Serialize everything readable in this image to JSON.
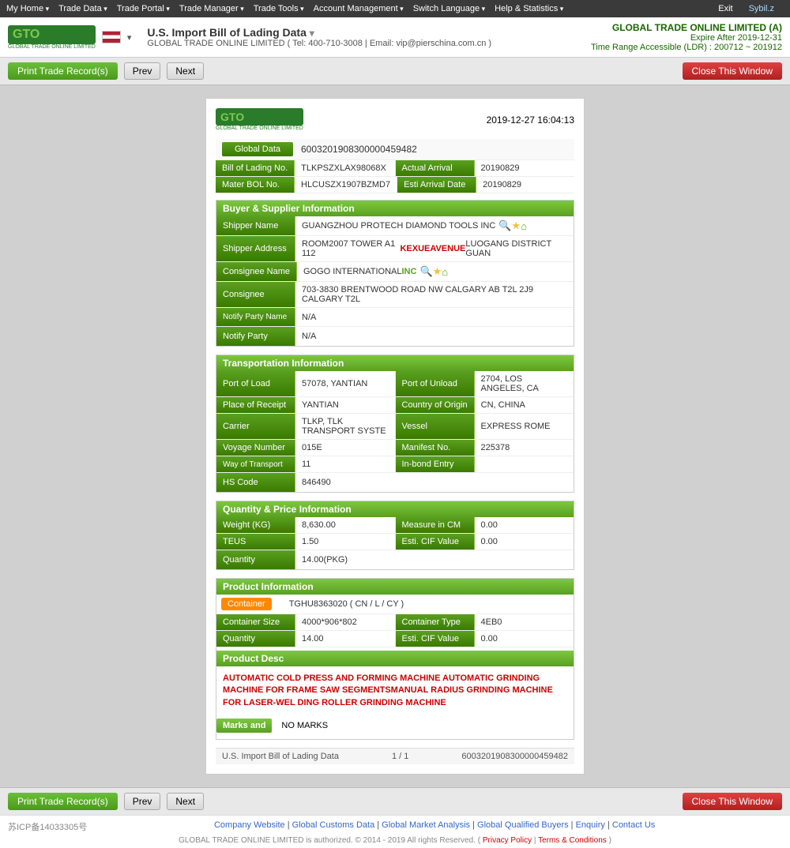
{
  "nav": {
    "items": [
      "My Home",
      "Trade Data",
      "Trade Portal",
      "Trade Manager",
      "Trade Tools",
      "Account Management",
      "Switch Language",
      "Help & Statistics",
      "Exit"
    ],
    "user": "Sybil.z"
  },
  "header": {
    "title": "U.S. Import Bill of Lading Data",
    "company_line": "GLOBAL TRADE ONLINE LIMITED ( Tel: 400-710-3008 | Email: vip@pierschina.com.cn )",
    "top_company": "GLOBAL TRADE ONLINE LIMITED (A)",
    "expire": "Expire After 2019-12-31",
    "time_range": "Time Range Accessible (LDR) : 200712 ~ 201912"
  },
  "toolbar": {
    "print_label": "Print Trade Record(s)",
    "prev_label": "Prev",
    "next_label": "Next",
    "close_label": "Close This Window"
  },
  "record": {
    "timestamp": "2019-12-27 16:04:13",
    "global_data_label": "Global Data",
    "global_data_value": "6003201908300000459482",
    "bill_of_lading_label": "Bill of Lading No.",
    "bill_of_lading_value": "TLKPSZXLAX98068X",
    "actual_arrival_label": "Actual Arrival",
    "actual_arrival_value": "20190829",
    "master_bol_label": "Mater BOL No.",
    "master_bol_value": "HLCUSZX1907BZMD7",
    "esti_arrival_label": "Esti Arrival Date",
    "esti_arrival_value": "20190829"
  },
  "buyer_supplier": {
    "section_title": "Buyer & Supplier Information",
    "shipper_name_label": "Shipper Name",
    "shipper_name_value": "GUANGZHOU PROTECH DIAMOND TOOLS INC",
    "shipper_address_label": "Shipper Address",
    "shipper_address_value": "ROOM2007 TOWER A1 112 KEXUE AVENUE LUOGANG DISTRICT GUAN",
    "consignee_name_label": "Consignee Name",
    "consignee_name_value": "GOGO INTERNATIONAL INC",
    "consignee_label": "Consignee",
    "consignee_value": "703-3830 BRENTWOOD ROAD NW CALGARY AB T2L 2J9 CALGARY T2L",
    "notify_party_name_label": "Notify Party Name",
    "notify_party_name_value": "N/A",
    "notify_party_label": "Notify Party",
    "notify_party_value": "N/A"
  },
  "transportation": {
    "section_title": "Transportation Information",
    "port_of_load_label": "Port of Load",
    "port_of_load_value": "57078, YANTIAN",
    "port_of_unload_label": "Port of Unload",
    "port_of_unload_value": "2704, LOS ANGELES, CA",
    "place_of_receipt_label": "Place of Receipt",
    "place_of_receipt_value": "YANTIAN",
    "country_of_origin_label": "Country of Origin",
    "country_of_origin_value": "CN, CHINA",
    "carrier_label": "Carrier",
    "carrier_value": "TLKP, TLK TRANSPORT SYSTE",
    "vessel_label": "Vessel",
    "vessel_value": "EXPRESS ROME",
    "voyage_number_label": "Voyage Number",
    "voyage_number_value": "015E",
    "manifest_no_label": "Manifest No.",
    "manifest_no_value": "225378",
    "way_of_transport_label": "Way of Transport",
    "way_of_transport_value": "11",
    "in_bond_entry_label": "In-bond Entry",
    "in_bond_entry_value": "",
    "hs_code_label": "HS Code",
    "hs_code_value": "846490"
  },
  "quantity_price": {
    "section_title": "Quantity & Price Information",
    "weight_label": "Weight (KG)",
    "weight_value": "8,630.00",
    "measure_label": "Measure in CM",
    "measure_value": "0.00",
    "teus_label": "TEUS",
    "teus_value": "1.50",
    "esti_cif_label": "Esti. CIF Value",
    "esti_cif_value": "0.00",
    "quantity_label": "Quantity",
    "quantity_value": "14.00(PKG)"
  },
  "product": {
    "section_title": "Product Information",
    "container_badge": "Container",
    "container_value": "TGHU8363020 ( CN / L / CY )",
    "container_size_label": "Container Size",
    "container_size_value": "4000*906*802",
    "container_type_label": "Container Type",
    "container_type_value": "4EB0",
    "quantity_label": "Quantity",
    "quantity_value": "14.00",
    "esti_cif_label": "Esti. CIF Value",
    "esti_cif_value": "0.00",
    "product_desc_label": "Product Desc",
    "product_desc": "AUTOMATIC COLD PRESS AND FORMING MACHINE AUTOMATIC GRINDING MACHINE FOR FRAME SAW SEGMENTSMANUAL RADIUS GRINDING MACHINE FOR LASER-WEL DING ROLLER GRINDING MACHINE",
    "marks_label": "Marks and",
    "marks_value": "NO MARKS"
  },
  "footer": {
    "source": "U.S. Import Bill of Lading Data",
    "page": "1 / 1",
    "record_id": "6003201908300000459482"
  },
  "bottom_links": {
    "company_website": "Company Website",
    "global_customs": "Global Customs Data",
    "global_market": "Global Market Analysis",
    "global_qualified": "Global Qualified Buyers",
    "enquiry": "Enquiry",
    "contact_us": "Contact Us",
    "icp": "苏ICP备14033305号",
    "copyright": "GLOBAL TRADE ONLINE LIMITED is authorized. © 2014 - 2019 All rights Reserved. (",
    "privacy_policy": "Privacy Policy",
    "terms": "Terms & Conditions",
    "copyright_end": ")"
  }
}
